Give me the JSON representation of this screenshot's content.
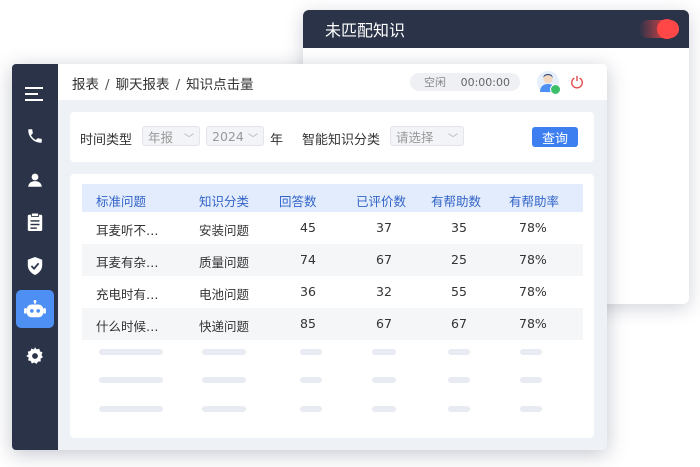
{
  "back_window": {
    "title": "未匹配知识"
  },
  "breadcrumb": [
    "报表",
    "聊天报表",
    "知识点击量"
  ],
  "status": {
    "state": "空闲",
    "timer": "00:00:00"
  },
  "sidebar": {
    "items": [
      {
        "icon": "menu-icon"
      },
      {
        "icon": "phone-icon"
      },
      {
        "icon": "user-icon"
      },
      {
        "icon": "clipboard-icon"
      },
      {
        "icon": "shield-icon"
      },
      {
        "icon": "robot-icon",
        "active": true
      },
      {
        "icon": "gear-icon"
      }
    ]
  },
  "filters": {
    "time_type_label": "时间类型",
    "time_type_value": "年报",
    "year_value": "2024",
    "year_suffix": "年",
    "category_label": "智能知识分类",
    "category_placeholder": "请选择",
    "query_label": "查询"
  },
  "table": {
    "headers": [
      "标准问题",
      "知识分类",
      "回答数",
      "已评价数",
      "有帮助数",
      "有帮助率"
    ],
    "rows": [
      [
        "耳麦听不…",
        "安装问题",
        "45",
        "37",
        "35",
        "78%"
      ],
      [
        "耳麦有杂…",
        "质量问题",
        "74",
        "67",
        "25",
        "78%"
      ],
      [
        "充电时有…",
        "电池问题",
        "36",
        "32",
        "55",
        "78%"
      ],
      [
        "什么时候…",
        "快递问题",
        "85",
        "67",
        "67",
        "78%"
      ]
    ]
  },
  "colors": {
    "accent": "#3d7ff0",
    "sidebar": "#2b3348",
    "header_bg": "#e3ecfc",
    "toggle": "#ff4747"
  }
}
